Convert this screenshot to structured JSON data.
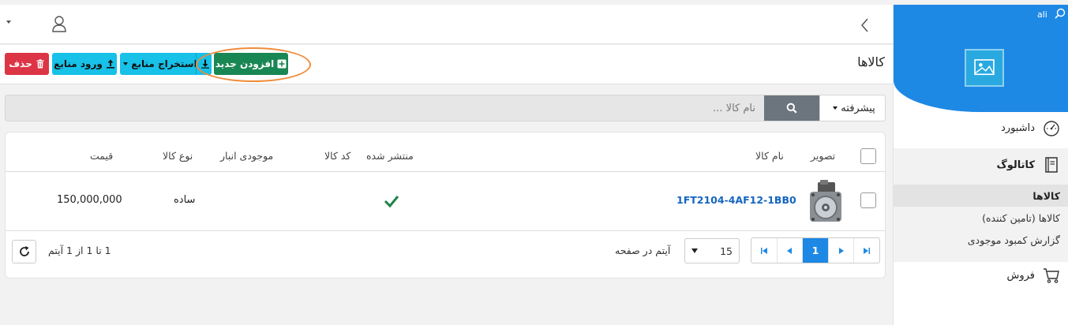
{
  "sidebar": {
    "user_name": "ali",
    "menu": {
      "dashboard": "داشبورد",
      "catalog": "کاتالوگ",
      "catalog_items": [
        "کالاها",
        "کالاها (تامین کننده)",
        "گزارش کمبود موجودی"
      ],
      "sales": "فروش"
    }
  },
  "toolbar": {
    "page_title": "کالاها",
    "add_label": "افزودن جدید",
    "export_label": "استخراج منابع",
    "import_label": "ورود منابع",
    "delete_label": "حذف"
  },
  "search": {
    "placeholder": "نام کالا ...",
    "advanced_label": "پیشرفته"
  },
  "grid": {
    "columns": {
      "image": "تصویر",
      "name": "نام کالا",
      "published": "منتشر شده",
      "sku": "کد کالا",
      "stock": "موجودی انبار",
      "type": "نوع کالا",
      "price": "قیمت"
    },
    "rows": [
      {
        "name": "1FT2104-4AF12-1BB0",
        "published": true,
        "sku": "",
        "stock": "",
        "type": "ساده",
        "price": "150,000,000"
      }
    ]
  },
  "pager": {
    "current_page": "1",
    "page_size": "15",
    "per_page_label": "آیتم در صفحه",
    "info": "1 تا 1 از 1 آیتم"
  },
  "colors": {
    "primary": "#1e88e5",
    "success": "#198754",
    "info": "#17c1e8",
    "danger": "#dc3545",
    "highlight": "#f08c3a"
  }
}
